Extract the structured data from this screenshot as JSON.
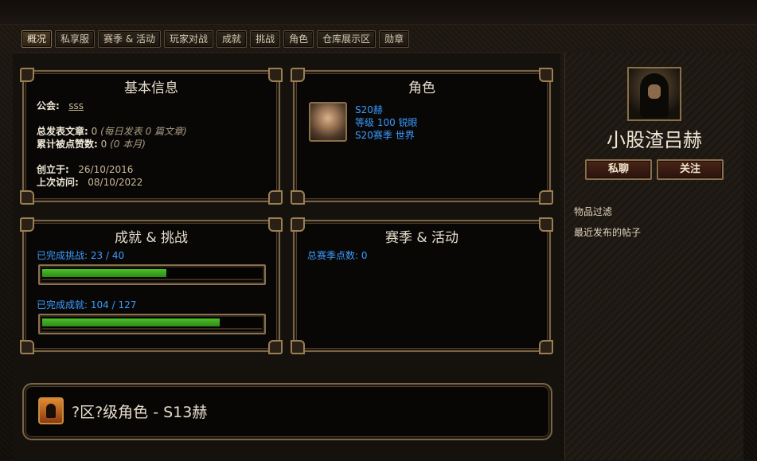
{
  "tabs": [
    "概况",
    "私享服",
    "赛季 & 活动",
    "玩家对战",
    "成就",
    "挑战",
    "角色",
    "仓库展示区",
    "勋章"
  ],
  "active_tab_index": 0,
  "basic_info": {
    "title": "基本信息",
    "guild_label": "公会:",
    "guild_value": "sss",
    "posts_label": "总发表文章:",
    "posts_value": "0",
    "posts_note": "(每日发表 0 篇文章)",
    "likes_label": "累计被点赞数:",
    "likes_value": "0",
    "likes_note": "(0 本月)",
    "created_label": "创立于:",
    "created_value": "26/10/2016",
    "last_visit_label": "上次访问:",
    "last_visit_value": "08/10/2022"
  },
  "characters": {
    "title": "角色",
    "hero_name": "S20赫",
    "hero_level": "等级 100 锐眼",
    "hero_season": "S20赛季 世界"
  },
  "achievements": {
    "title": "成就 & 挑战",
    "challenges_label": "已完成挑战:",
    "challenges_value": "23 / 40",
    "challenges_progress": 0.575,
    "achievements_label": "已完成成就:",
    "achievements_value": "104 / 127",
    "achievements_progress": 0.819
  },
  "season": {
    "title": "赛季 & 活动",
    "points_label": "总赛季点数:",
    "points_value": "0"
  },
  "profile": {
    "username": "小股渣吕赫",
    "message_button": "私聊",
    "follow_button": "关注",
    "links": [
      "物品过滤",
      "最近发布的帖子"
    ]
  },
  "featured_character": {
    "text": "?区?级角色 - S13赫"
  },
  "colors": {
    "accent_blue": "#3a9bff",
    "progress_green": "#3ea81f",
    "frame_gold": "#7a6446"
  }
}
